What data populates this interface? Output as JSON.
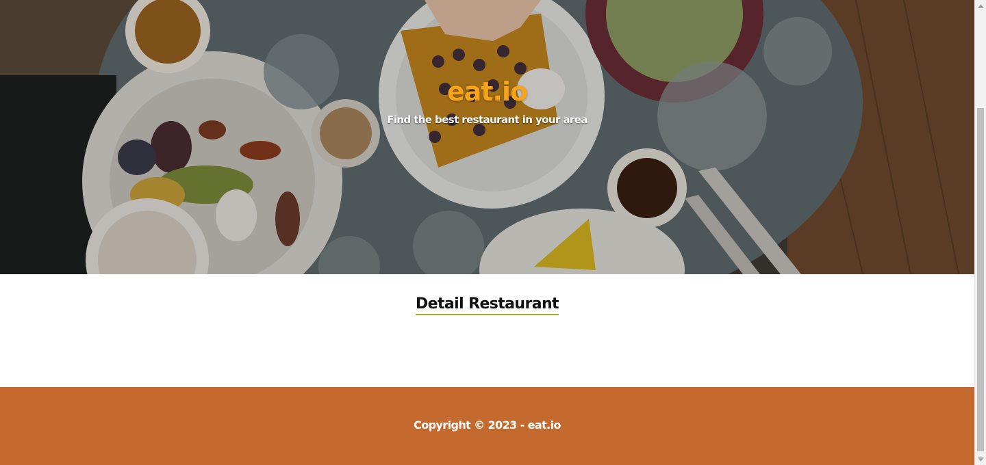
{
  "hero": {
    "brand": "eat.io",
    "tagline": "Find the best restaurant in your area",
    "background_image": "restaurant table with breakfast dishes"
  },
  "main": {
    "section_title": "Detail Restaurant"
  },
  "footer": {
    "copyright": "Copyright © 2023 - eat.io"
  },
  "icons": {
    "scroll_up": "chevron-up-icon",
    "scroll_down": "chevron-down-icon"
  },
  "colors": {
    "brand": "#f7a41a",
    "footer_bg": "#c56a2e",
    "title_underline": "#b5a22a",
    "tagline": "#ffffff"
  }
}
